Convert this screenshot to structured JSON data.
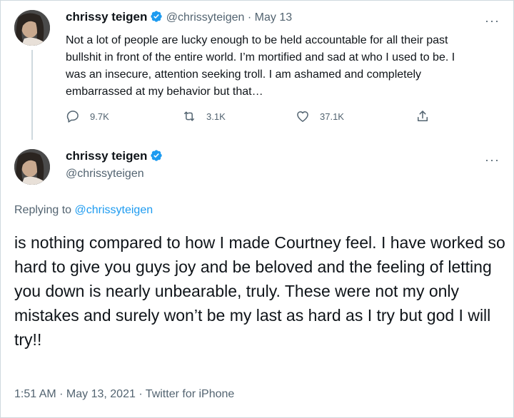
{
  "tweet1": {
    "display_name": "chrissy teigen",
    "handle": "@chrissyteigen",
    "separator": "·",
    "date": "May 13",
    "more": "···",
    "text": "Not a lot of people are lucky enough to be held accountable for all their past bullshit in front of the entire world. I’m mortified and sad at who I used to be. I was an insecure, attention seeking troll. I am ashamed and completely embarrassed at my behavior but that…",
    "stats": {
      "replies": "9.7K",
      "retweets": "3.1K",
      "likes": "37.1K"
    }
  },
  "tweet2": {
    "display_name": "chrissy teigen",
    "handle": "@chrissyteigen",
    "more": "···",
    "replying_prefix": "Replying to ",
    "replying_to": "@chrissyteigen",
    "text": "is nothing compared to how I made Courtney feel. I have worked so hard to give you guys joy and be beloved and the feeling of letting you down is nearly unbearable, truly. These were not my only mistakes and surely won’t be my last as hard as I try but god I will try!!",
    "meta": "1:51 AM · May 13, 2021 · Twitter for iPhone"
  },
  "icons": {
    "verified": "verified-badge-icon",
    "reply": "reply-icon",
    "retweet": "retweet-icon",
    "like": "heart-icon",
    "share": "share-icon"
  },
  "colors": {
    "text": "#0f1419",
    "muted": "#536471",
    "link": "#1d9bf0",
    "verified": "#1d9bf0",
    "border": "#cfd9de"
  }
}
